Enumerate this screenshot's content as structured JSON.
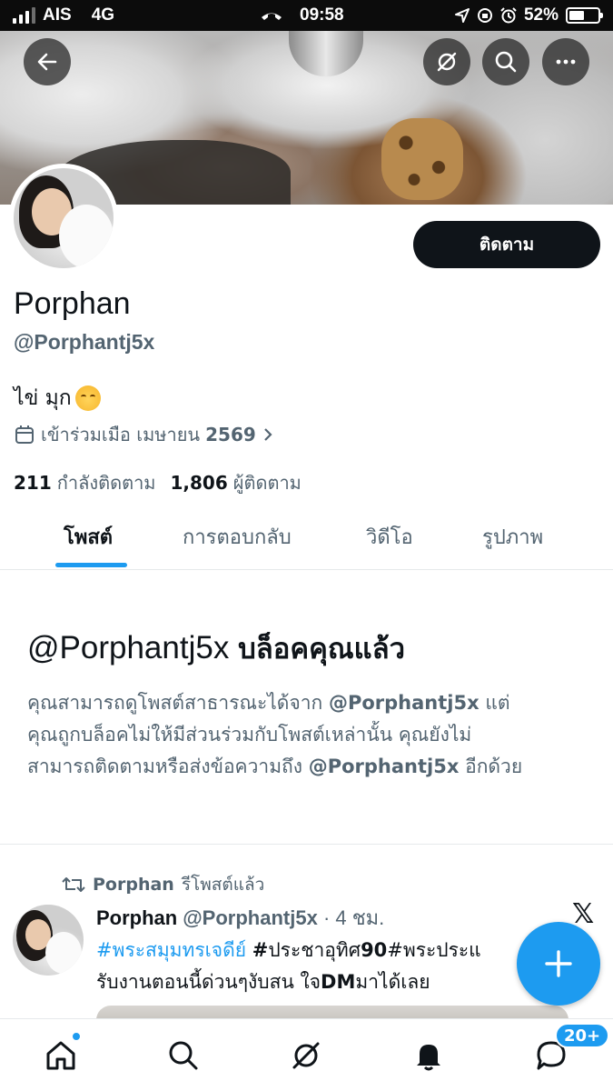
{
  "status_bar": {
    "carrier": "AIS",
    "network": "4G",
    "time": "09:58",
    "battery": "52%",
    "battery_level": 0.52
  },
  "header": {
    "back_icon": "arrow-left-icon",
    "grok_icon": "grok-icon",
    "search_icon": "search-icon",
    "more_icon": "more-dots-icon"
  },
  "profile": {
    "name": "Porphan",
    "handle": "@Porphantj5x",
    "bio": "ไข่ มุก",
    "bio_emoji": "kissing-face-emoji",
    "joined_label": "เข้าร่วมเมือ เมษายน",
    "joined_year": "2569",
    "following_count": "211",
    "following_label": "กำลังติดตาม",
    "followers_count": "1,806",
    "followers_label": "ผู้ติดตาม",
    "follow_button": "ติดตาม"
  },
  "tabs": [
    {
      "label": "โพสต์",
      "active": true
    },
    {
      "label": "การตอบกลับ",
      "active": false
    },
    {
      "label": "วิดีโอ",
      "active": false
    },
    {
      "label": "รูปภาพ",
      "active": false
    }
  ],
  "blocked": {
    "title_handle": "@Porphantj5x",
    "title_text": "บล็อคคุณแล้ว",
    "line1_a": "คุณสามารถดูโพสต์สาธารณะได้จาก",
    "line1_handle": "@Porphantj5x",
    "line1_b": "แต่",
    "line2": "คุณถูกบล็อคไม่ให้มีส่วนร่วมกับโพสต์เหล่านั้น คุณยังไม่",
    "line3_a": "สามารถติดตามหรือส่งข้อความถึง",
    "line3_handle": "@Porphantj5x",
    "line3_b": "อีกด้วย"
  },
  "post": {
    "repost_name": "Porphan",
    "repost_label": "รีโพสต์แล้ว",
    "author_name": "Porphan",
    "author_handle": "@Porphantj5x",
    "time": "· 4 ชม.",
    "line1_tag": "#พระสมุมทรเจดีย์",
    "line1_hash": "#",
    "line1_a": "ประชาอุทิศ",
    "line1_num": "90",
    "line1_b": "#พระประแ",
    "line2_a": "รับงานตอนนี้ด่วนๆงับสน ใจ",
    "line2_dm": "DM",
    "line2_b": "มาได้เลย",
    "x_logo": "𝕏"
  },
  "fab": {
    "icon": "plus-icon"
  },
  "bottom_nav": {
    "home_icon": "home-icon",
    "search_icon": "search-icon",
    "grok_icon": "grok-icon",
    "notifications_icon": "bell-icon",
    "messages_icon": "messages-icon",
    "messages_badge": "20+"
  },
  "colors": {
    "accent": "#1d9bf0",
    "text_primary": "#0f1419",
    "text_secondary": "#536471",
    "button_dark": "#0f1419"
  }
}
